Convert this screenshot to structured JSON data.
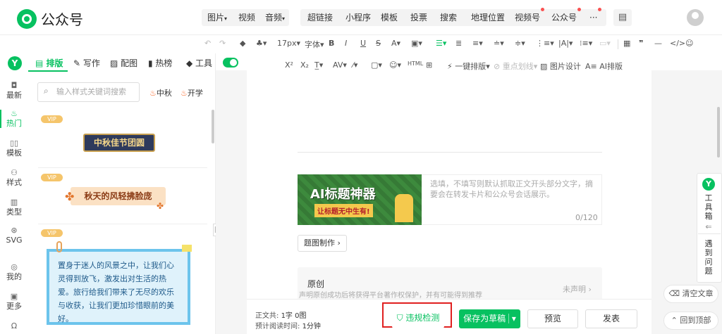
{
  "app": {
    "name": "公众号"
  },
  "top_menu": [
    {
      "label": "图片",
      "caret": "▾"
    },
    {
      "label": "视频"
    },
    {
      "label": "音频",
      "caret": "▾"
    },
    {
      "label": "超链接"
    },
    {
      "label": "小程序"
    },
    {
      "label": "模板"
    },
    {
      "label": "投票"
    },
    {
      "label": "搜索"
    },
    {
      "label": "地理位置"
    },
    {
      "label": "视频号"
    },
    {
      "label": "公众号"
    },
    {
      "label": "···"
    }
  ],
  "toolbar1": {
    "font_size": "17px",
    "font": "字体"
  },
  "toolbar2": {
    "one_click": "一键排版",
    "focus": "重点划线",
    "img_design": "图片设计",
    "ai": "AI排版"
  },
  "panel_tabs": [
    {
      "label": "排版"
    },
    {
      "label": "写作"
    },
    {
      "label": "配图"
    },
    {
      "label": "热榜"
    },
    {
      "label": "工具"
    }
  ],
  "left_rail": [
    {
      "label": "最新",
      "icon": "chat-icon"
    },
    {
      "label": "热门",
      "icon": "fire-icon"
    },
    {
      "label": "模板",
      "icon": "template-icon"
    },
    {
      "label": "样式",
      "icon": "style-icon"
    },
    {
      "label": "类型",
      "icon": "type-icon"
    },
    {
      "label": "SVG",
      "icon": "svg-icon"
    },
    {
      "label": "我的",
      "icon": "user-icon"
    },
    {
      "label": "更多",
      "icon": "grid-icon"
    }
  ],
  "search": {
    "placeholder": "输入样式关键词搜索",
    "hot1": "中秋",
    "hot2": "开学"
  },
  "templates": [
    {
      "badge": "VIP",
      "text": "中秋佳节团圆"
    },
    {
      "badge": "VIP",
      "text": "秋天的风轻拂脸庞"
    },
    {
      "badge": "VIP",
      "text": "置身于迷人的风景之中，让我们心灵得到放飞，激发出对生活的热爱。旅行给我们带来了无尽的欢乐与收获，让我们更加珍惜眼前的美好。"
    }
  ],
  "cover": {
    "line1": "AI标题神器",
    "line2": "让标题无中生有!",
    "summary_placeholder": "选填，不填写则默认抓取正文开头部分文字，摘要会在转发卡片和公众号会话展示。",
    "count": "0/120",
    "make_button": "题图制作"
  },
  "original": {
    "title": "原创",
    "desc": "声明原创成功后将获得平台著作权保护，并有可能得到推荐",
    "status": "未声明"
  },
  "footer": {
    "word_count_label": "正文共:",
    "word_count_value": "1字 0图",
    "read_time_label": "预计阅读时间:",
    "read_time_value": "1分钟",
    "check_button": "违规检测",
    "save_button": "保存为草稿",
    "preview_button": "预览",
    "publish_button": "发表"
  },
  "side_panel": {
    "title": "工具箱",
    "issue": "遇到问题"
  },
  "float": {
    "clear": "清空文章",
    "top": "回到顶部"
  },
  "colors": {
    "brand": "#07c160",
    "highlight": "#e02020",
    "vip": "#f5c56b",
    "panel_accent": "#07c160"
  }
}
